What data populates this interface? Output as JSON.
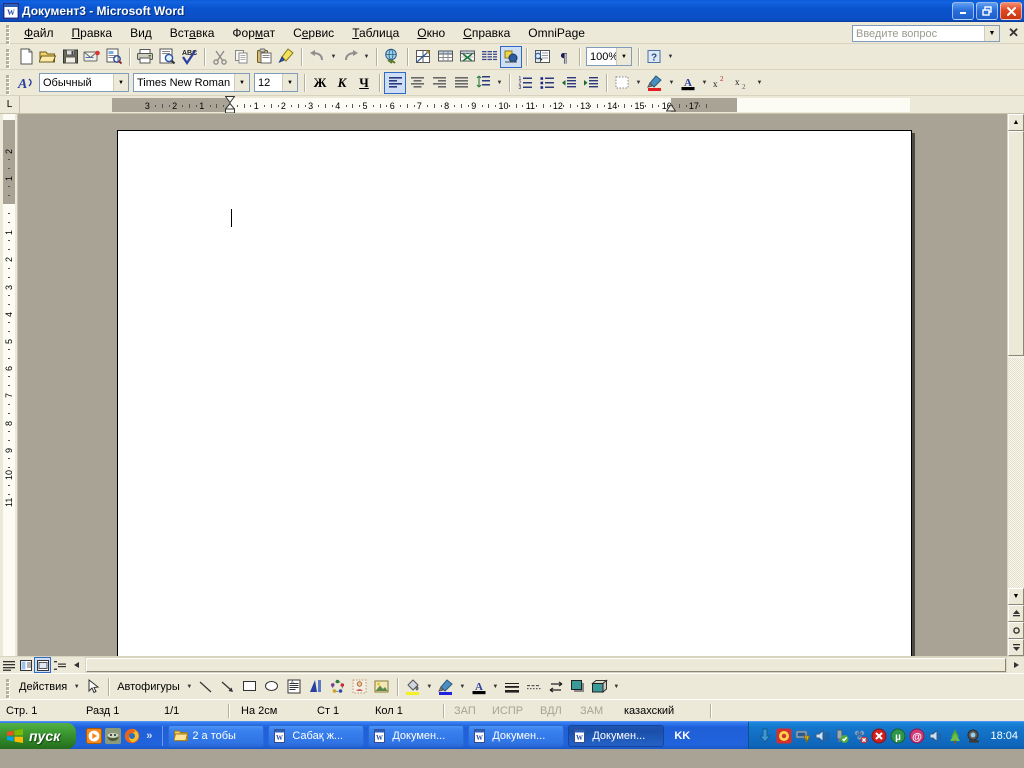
{
  "window": {
    "title": "Документ3 - Microsoft Word",
    "app_icon": "word-document-icon",
    "minimize_label": "_",
    "maximize_label": "❐",
    "close_label": "✕"
  },
  "menu": {
    "items": [
      {
        "label": "Файл",
        "accel": "Ф"
      },
      {
        "label": "Правка",
        "accel": "П"
      },
      {
        "label": "Вид",
        "accel": "д"
      },
      {
        "label": "Вставка",
        "accel": "а"
      },
      {
        "label": "Формат",
        "accel": "м"
      },
      {
        "label": "Сервис",
        "accel": "е"
      },
      {
        "label": "Таблица",
        "accel": "Т"
      },
      {
        "label": "Окно",
        "accel": "О"
      },
      {
        "label": "Справка",
        "accel": "С"
      },
      {
        "label": "OmniPage",
        "accel": ""
      }
    ],
    "ask_placeholder": "Введите вопрос",
    "ask_value": "",
    "ask_close_label": "✕"
  },
  "standard_toolbar": {
    "buttons": [
      {
        "name": "new-document",
        "tip": "Создать"
      },
      {
        "name": "open-folder",
        "tip": "Открыть"
      },
      {
        "name": "save-disk",
        "tip": "Сохранить"
      },
      {
        "name": "email-envelope",
        "tip": "Сообщение"
      },
      {
        "name": "search-file",
        "tip": "Поиск"
      },
      {
        "name": "print",
        "tip": "Печать"
      },
      {
        "name": "print-preview",
        "tip": "Предварительный просмотр"
      },
      {
        "name": "spellcheck-abc",
        "tip": "Правописание"
      },
      {
        "name": "cut-scissors",
        "tip": "Вырезать"
      },
      {
        "name": "copy-pages",
        "tip": "Копировать"
      },
      {
        "name": "paste-clipboard",
        "tip": "Вставить"
      },
      {
        "name": "format-painter-brush",
        "tip": "Формат по образцу"
      },
      {
        "name": "undo-arrow",
        "tip": "Отменить"
      },
      {
        "name": "redo-arrow",
        "tip": "Вернуть"
      },
      {
        "name": "hyperlink-globe",
        "tip": "Гиперссылка"
      },
      {
        "name": "tables-and-borders",
        "tip": "Таблицы и границы"
      },
      {
        "name": "insert-table",
        "tip": "Добавить таблицу"
      },
      {
        "name": "insert-excel-sheet",
        "tip": "Добавить лист Excel"
      },
      {
        "name": "columns",
        "tip": "Колонки"
      },
      {
        "name": "drawing-toggle",
        "tip": "Рисование"
      },
      {
        "name": "document-map",
        "tip": "Схема документа"
      },
      {
        "name": "show-formatting-marks",
        "tip": "Непечатаемые знаки"
      },
      {
        "name": "office-assistant-help",
        "tip": "Справка"
      }
    ],
    "zoom_value": "100%"
  },
  "formatting_toolbar": {
    "styles_icon": "styles-and-formatting-icon",
    "style_value": "Обычный",
    "font_value": "Times New Roman",
    "size_value": "12",
    "bold_label": "Ж",
    "italic_label": "К",
    "underline_label": "Ч",
    "buttons": [
      {
        "name": "align-left",
        "state": "pressed"
      },
      {
        "name": "align-center",
        "state": "normal"
      },
      {
        "name": "align-right",
        "state": "normal"
      },
      {
        "name": "align-justify",
        "state": "normal"
      },
      {
        "name": "line-spacing",
        "state": "normal"
      },
      {
        "name": "numbered-list",
        "state": "normal"
      },
      {
        "name": "bulleted-list",
        "state": "normal"
      },
      {
        "name": "decrease-indent",
        "state": "normal"
      },
      {
        "name": "increase-indent",
        "state": "normal"
      },
      {
        "name": "borders",
        "state": "normal"
      },
      {
        "name": "highlight-color",
        "state": "normal"
      },
      {
        "name": "font-color",
        "state": "normal"
      },
      {
        "name": "superscript",
        "state": "normal"
      },
      {
        "name": "subscript",
        "state": "normal"
      }
    ],
    "superscript_label": "x²",
    "subscript_label": "x₂"
  },
  "ruler": {
    "tab_selector_glyph": "L",
    "horizontal_left_labels": [
      "3",
      "2",
      "1"
    ],
    "horizontal_labels": [
      "1",
      "2",
      "3",
      "4",
      "5",
      "6",
      "7",
      "8",
      "9",
      "10",
      "11",
      "12",
      "13",
      "14",
      "15",
      "16"
    ],
    "horizontal_right_labels": [
      "17"
    ],
    "vertical_labels_gray": [
      "2",
      "1"
    ],
    "vertical_labels": [
      "1",
      "2",
      "3",
      "4",
      "5",
      "6",
      "7",
      "8",
      "9",
      "10",
      "11"
    ],
    "units": "см"
  },
  "document": {
    "page_number": 1,
    "content": ""
  },
  "view_buttons": [
    {
      "name": "normal-view",
      "selected": false
    },
    {
      "name": "web-layout-view",
      "selected": false
    },
    {
      "name": "print-layout-view",
      "selected": true
    },
    {
      "name": "outline-view",
      "selected": false
    }
  ],
  "drawing_toolbar": {
    "actions_label": "Действия",
    "autoshapes_label": "Автофигуры",
    "buttons": [
      {
        "name": "select-objects-arrow"
      },
      {
        "name": "line-tool"
      },
      {
        "name": "arrow-tool"
      },
      {
        "name": "rectangle-tool"
      },
      {
        "name": "oval-tool"
      },
      {
        "name": "text-box-tool"
      },
      {
        "name": "wordart-tool"
      },
      {
        "name": "diagram-tool"
      },
      {
        "name": "clip-art-tool"
      },
      {
        "name": "insert-picture-tool"
      },
      {
        "name": "fill-color"
      },
      {
        "name": "line-color"
      },
      {
        "name": "font-color"
      },
      {
        "name": "line-style"
      },
      {
        "name": "dash-style"
      },
      {
        "name": "arrow-style"
      },
      {
        "name": "shadow-style"
      },
      {
        "name": "3d-style"
      }
    ]
  },
  "statusbar": {
    "page": "Стр. 1",
    "section": "Разд 1",
    "pages": "1/1",
    "at": "На 2см",
    "line": "Ст 1",
    "column": "Кол 1",
    "rec": "ЗАП",
    "trk": "ИСПР",
    "ext": "ВДЛ",
    "ovr": "ЗАМ",
    "language": "казахский"
  },
  "taskbar": {
    "start_label": "пуск",
    "quicklaunch": [
      {
        "name": "media-player-icon"
      },
      {
        "name": "winamp-icon"
      },
      {
        "name": "firefox-icon"
      }
    ],
    "quicklaunch_more": "»",
    "tasks": [
      {
        "label": "2 а тобы",
        "icon": "folder-icon",
        "active": false
      },
      {
        "label": "Сабақ ж...",
        "icon": "word-icon",
        "active": false
      },
      {
        "label": "Докумен...",
        "icon": "word-icon",
        "active": false
      },
      {
        "label": "Докумен...",
        "icon": "word-icon",
        "active": false
      },
      {
        "label": "Докумен...",
        "icon": "word-icon",
        "active": true
      }
    ],
    "language_indicator": "KK",
    "tray_icons": [
      {
        "name": "download-arrow-icon",
        "color": "#2b7fd4"
      },
      {
        "name": "antivirus-shield-icon",
        "color": "#d32f2f"
      },
      {
        "name": "network-warning-icon",
        "color": "#7a9ec4"
      },
      {
        "name": "volume-icon",
        "color": "#2b6fbf"
      },
      {
        "name": "usb-safe-remove-icon",
        "color": "#5a9e3a"
      },
      {
        "name": "network-connection-error-icon",
        "color": "#c44040"
      },
      {
        "name": "security-alert-icon",
        "color": "#cc2222"
      },
      {
        "name": "utorrent-icon",
        "color": "#2e9648"
      },
      {
        "name": "mail-icon",
        "color": "#d03a78"
      },
      {
        "name": "speaker-icon",
        "color": "#2b6fbf"
      },
      {
        "name": "green-tree-icon",
        "color": "#4aa23a"
      },
      {
        "name": "webcam-icon",
        "color": "#6b6b6b"
      }
    ],
    "clock": "18:04"
  }
}
